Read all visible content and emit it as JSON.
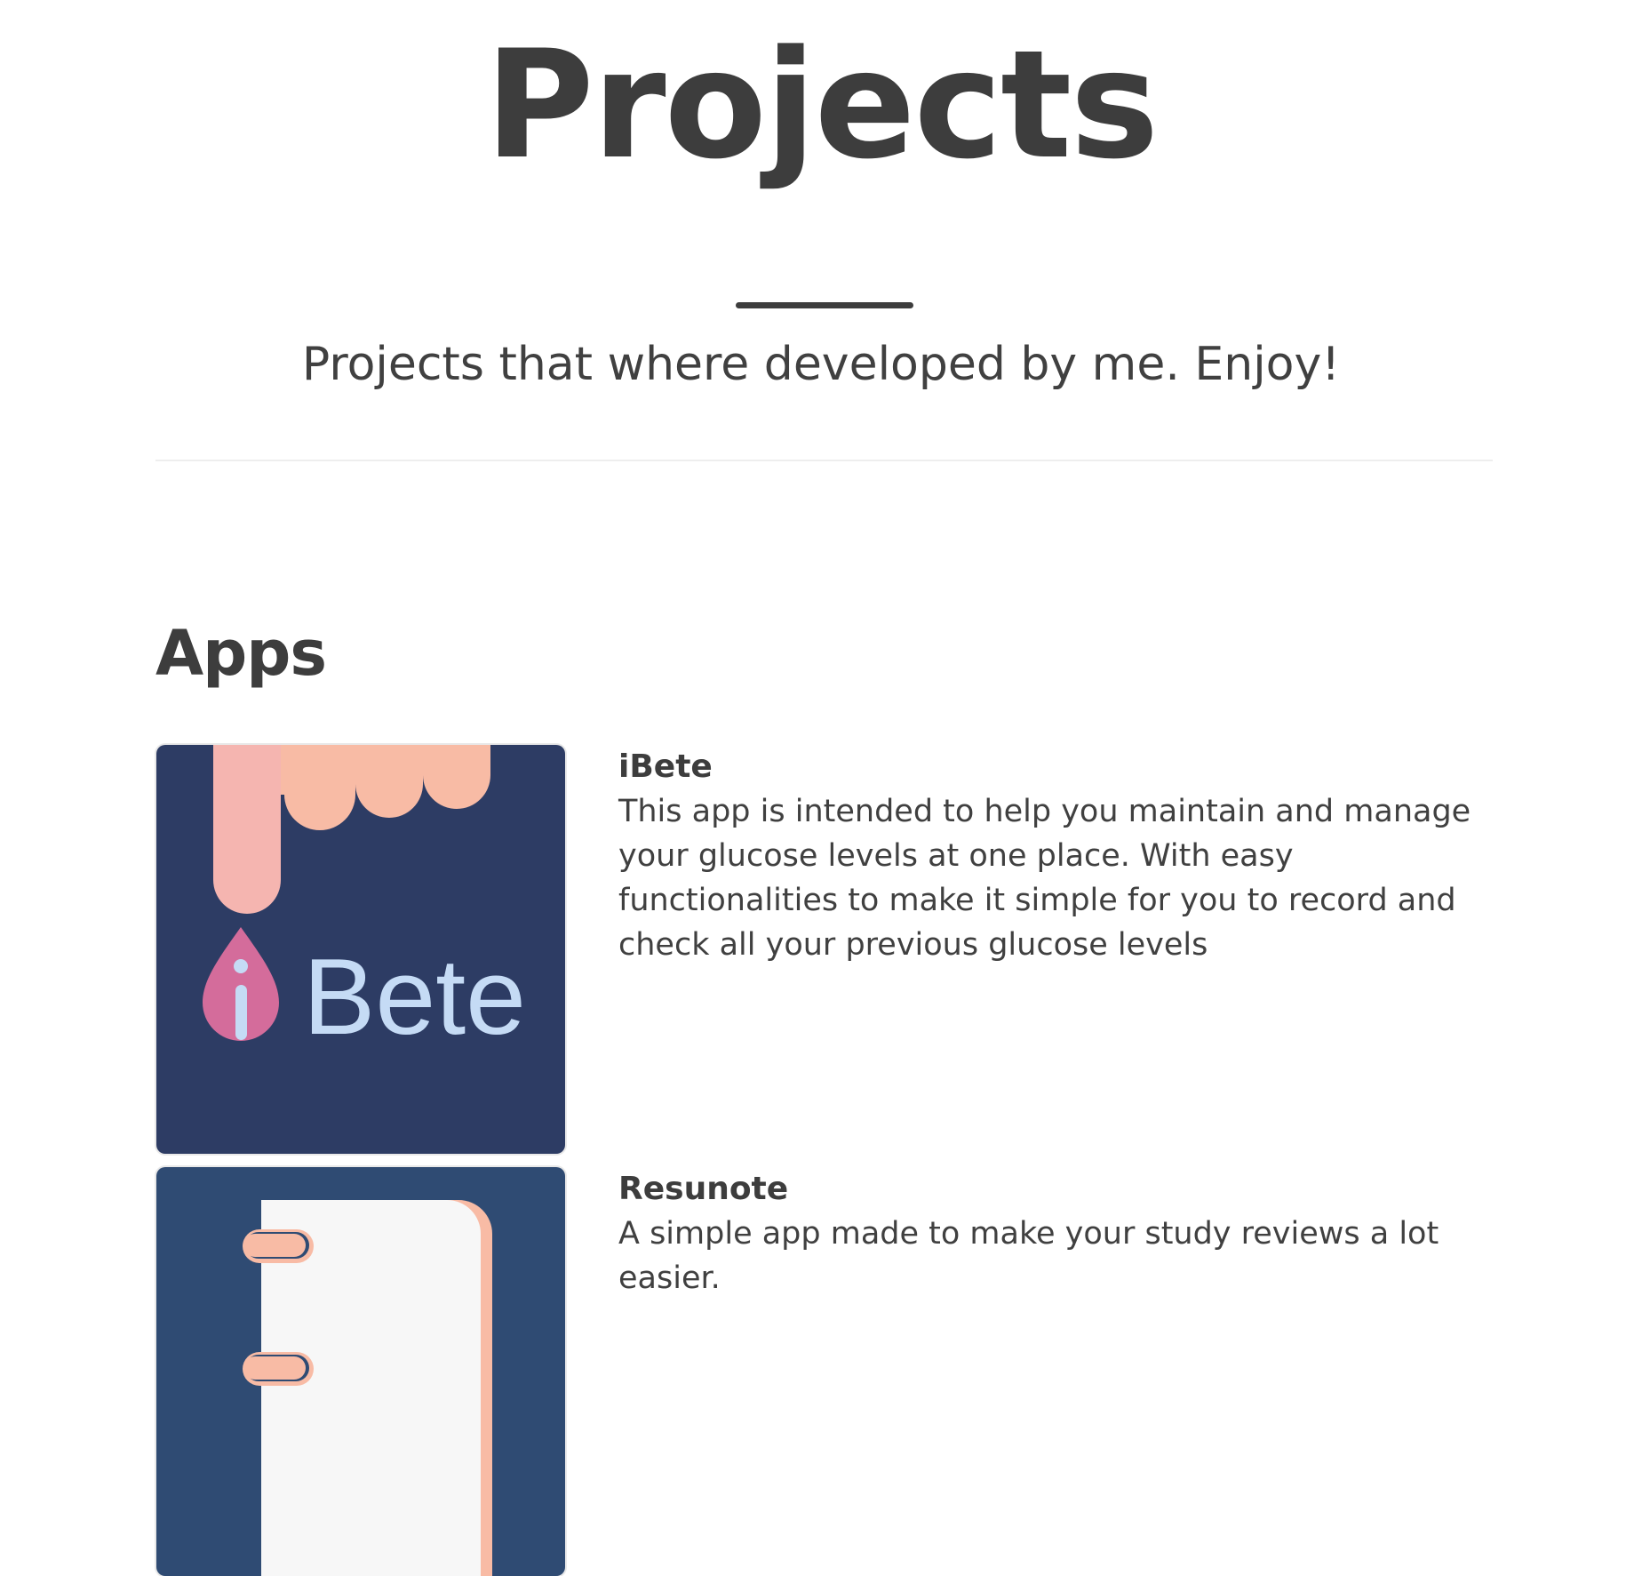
{
  "header": {
    "title": "Projects",
    "subtitle": "Projects that where developed by me. Enjoy!"
  },
  "apps_section": {
    "heading": "Apps",
    "items": [
      {
        "name": "iBete",
        "description": "This app is intended to help you maintain and manage your glucose levels at one place. With easy functionalities to make it simple for you to record and check all your previous glucose levels",
        "logo_text": "Bete",
        "logo_letter": "i",
        "colors": {
          "background": "#2d3c64",
          "drip_pink": "#f5b5b0",
          "drip_peach": "#f8bba5",
          "drop": "#d46c9b",
          "text": "#c5dbf5"
        }
      },
      {
        "name": "Resunote",
        "description": "A simple app made to make your study reviews a lot easier.",
        "colors": {
          "background": "#2f4b73",
          "paper": "#f7f7f7",
          "accent": "#f8bba5"
        }
      }
    ]
  }
}
